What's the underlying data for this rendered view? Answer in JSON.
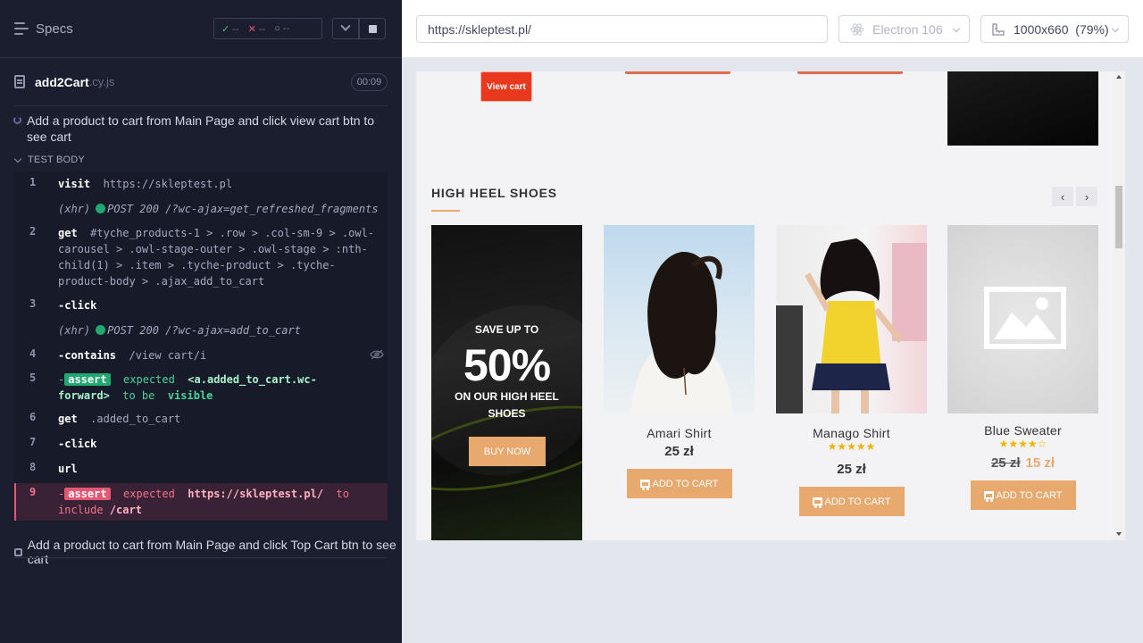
{
  "reporter": {
    "specs_label": "Specs",
    "stats": {
      "passed": "--",
      "failed": "--",
      "pending": "--"
    },
    "spec": {
      "name": "add2Cart",
      "ext": ".cy.js",
      "duration": "00:09"
    },
    "test_title": "Add a product to cart from Main Page and click view cart btn to see cart",
    "test_body_label": "TEST BODY",
    "commands": [
      {
        "num": "1",
        "name": "visit",
        "arg": "https://skleptest.pl"
      },
      {
        "xhr_label": "(xhr)",
        "xhr_text": "POST 200 /?wc-ajax=get_refreshed_fragments"
      },
      {
        "num": "2",
        "name": "get",
        "arg": "#tyche_products-1 > .row > .col-sm-9 > .owl-carousel > .owl-stage-outer > .owl-stage > :nth-child(1) > .item > .tyche-product > .tyche-product-body > .ajax_add_to_cart"
      },
      {
        "num": "3",
        "name": "-click"
      },
      {
        "xhr_label": "(xhr)",
        "xhr_text": "POST 200 /?wc-ajax=add_to_cart"
      },
      {
        "num": "4",
        "name": "-contains",
        "arg": "/view cart/i"
      },
      {
        "num": "5",
        "name": "-",
        "tag": "assert",
        "w1": "expected",
        "w2": "<a.added_to_cart.wc-forward>",
        "w3": "to be",
        "w4": "visible"
      },
      {
        "num": "6",
        "name": "get",
        "arg": ".added_to_cart"
      },
      {
        "num": "7",
        "name": "-click"
      },
      {
        "num": "8",
        "name": "url"
      },
      {
        "num": "9",
        "name": "-",
        "tag": "assert",
        "w1": "expected",
        "w2": "https://skleptest.pl/",
        "w3": "to include",
        "w4": "/cart"
      }
    ],
    "test2_title": "Add a product to cart from Main Page and click Top Cart btn to see cart"
  },
  "browser": {
    "url": "https://skleptest.pl/",
    "engine": "Electron 106",
    "viewport": "1000x660",
    "zoom": "(79%)"
  },
  "page": {
    "view_cart_label": "View cart",
    "section_title": "HIGH HEEL SHOES",
    "nav_prev": "‹",
    "nav_next": "›",
    "promo": {
      "line1": "SAVE UP TO",
      "line2": "50%",
      "line3": "ON OUR HIGH HEEL SHOES",
      "button": "BUY NOW"
    },
    "products": [
      {
        "name": "Amari Shirt",
        "rating": 0,
        "price": "25 zł",
        "button": "ADD TO CART"
      },
      {
        "name": "Manago Shirt",
        "rating": 5,
        "stars": "★★★★★",
        "price": "25 zł",
        "button": "ADD TO CART"
      },
      {
        "name": "Blue Sweater",
        "rating": 4,
        "stars": "★★★★☆",
        "old_price": "25 zł",
        "sale_price": "15 zł",
        "button": "ADD TO CART"
      }
    ]
  }
}
